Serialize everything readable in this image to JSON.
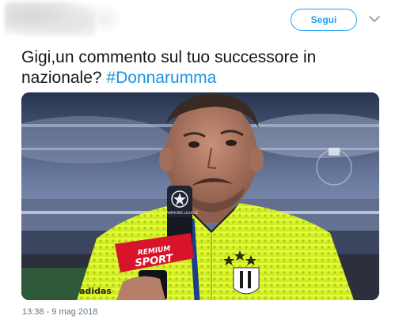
{
  "header": {
    "follow_label": "Segui"
  },
  "tweet": {
    "text_plain": "Gigi,un commento sul tuo successore in nazionale? ",
    "hashtag": "#Donnarumma",
    "timestamp": "13:38 - 9 mag 2018"
  },
  "media": {
    "mic_logo_text": "CHAMPIONS LEAGUE",
    "mic_brand_line1": "REMIUM",
    "mic_brand_line2": "SPORT",
    "shirt_sponsor": "adidas"
  },
  "colors": {
    "accent": "#1da1f2",
    "hashtag": "#1b95e0",
    "meta_text": "#657786",
    "body_text": "#14171a"
  },
  "icons": {
    "more": "chevron-down-icon"
  }
}
